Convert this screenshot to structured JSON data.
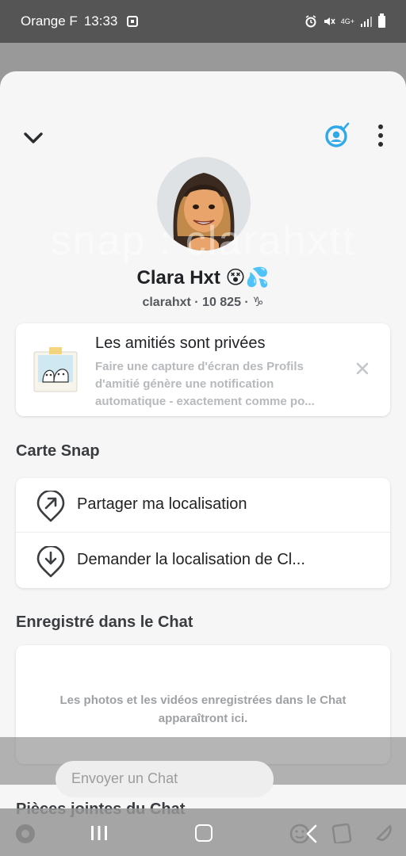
{
  "status_bar": {
    "carrier": "Orange F",
    "time": "13:33",
    "network": "4G+"
  },
  "profile": {
    "watermark": "snap : clarahxtt",
    "display_name": "Clara Hxt 😵💦",
    "username_line": "clarahxt · 10 825 · ♑"
  },
  "friendship_card": {
    "title": "Les amitiés sont privées",
    "description": "Faire une capture d'écran des Profils d'amitié génère une notification automatique - exactement comme po..."
  },
  "snap_map": {
    "section_title": "Carte Snap",
    "share_label": "Partager ma localisation",
    "request_label": "Demander la localisation de Cl..."
  },
  "saved_in_chat": {
    "section_title": "Enregistré dans le Chat",
    "empty_text": "Les photos et les vidéos enregistrées dans le Chat apparaîtront ici."
  },
  "attachments": {
    "section_title": "Pièces jointes du Chat"
  },
  "chat_bar": {
    "placeholder": "Envoyer un Chat"
  },
  "colors": {
    "accent_blue": "#2fa9e8",
    "sheet_bg": "#f6f6f6",
    "status_bar_bg": "#555555"
  }
}
